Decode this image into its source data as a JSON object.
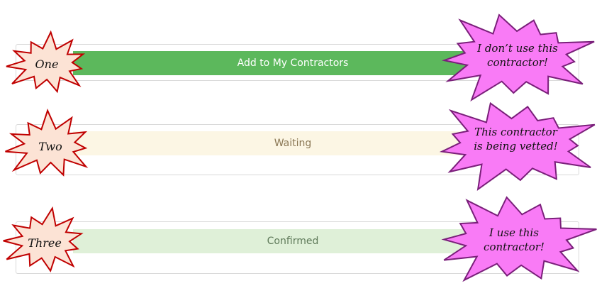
{
  "rows": [
    {
      "label": "One",
      "button": "Add to My Contractors",
      "note": "I don’t use this\ncontractor!"
    },
    {
      "label": "Two",
      "button": "Waiting",
      "note": "This contractor\nis being vetted!"
    },
    {
      "label": "Three",
      "button": "Confirmed",
      "note": "I use this\ncontractor!"
    }
  ],
  "colors": {
    "primary_green": "#5cb85c",
    "waiting_bg": "#fcf6e4",
    "confirmed_bg": "#dff0d8",
    "label_burst_fill": "#fce3d5",
    "label_burst_stroke": "#c00000",
    "note_burst_fill": "#f97bf6",
    "note_burst_stroke": "#7a1f7a"
  }
}
